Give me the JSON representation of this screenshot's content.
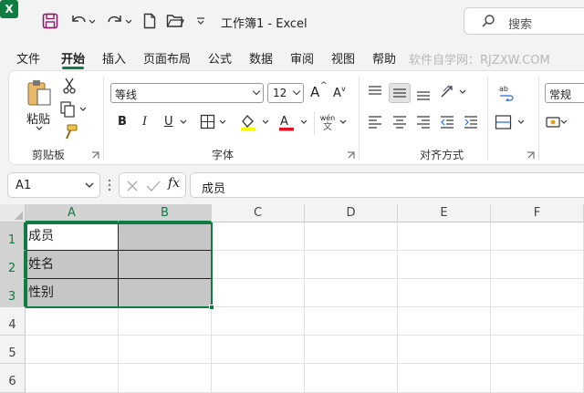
{
  "titlebar": {
    "app_icon": "excel-logo-icon",
    "app_letter": "X",
    "title": "工作簿1  -  Excel",
    "search_placeholder": "搜索"
  },
  "menu": {
    "tabs": [
      "文件",
      "开始",
      "插入",
      "页面布局",
      "公式",
      "数据",
      "审阅",
      "视图",
      "帮助"
    ],
    "active": "开始",
    "watermark": "软件自学网：RJZXW.COM"
  },
  "ribbon": {
    "clipboard": {
      "paste_label": "粘贴",
      "group_label": "剪贴板"
    },
    "font": {
      "font_name": "等线",
      "font_size": "12",
      "grow": "A",
      "shrink": "A",
      "bold": "B",
      "italic": "I",
      "underline": "U",
      "group_label": "字体",
      "font_color": "#e81123",
      "highlight_color": "#ffff00",
      "phonetic_top": "wén",
      "phonetic_bottom": "文"
    },
    "alignment": {
      "group_label": "对齐方式"
    },
    "number": {
      "format": "常规"
    }
  },
  "formula_bar": {
    "cell_ref": "A1",
    "fx": "fx",
    "content": "成员"
  },
  "grid": {
    "columns": [
      "A",
      "B",
      "C",
      "D",
      "E",
      "F"
    ],
    "rows": [
      "1",
      "2",
      "3",
      "4",
      "5",
      "6"
    ],
    "cells": {
      "A1": "成员",
      "A2": "姓名",
      "A3": "性别"
    },
    "accent": "#107c41"
  }
}
